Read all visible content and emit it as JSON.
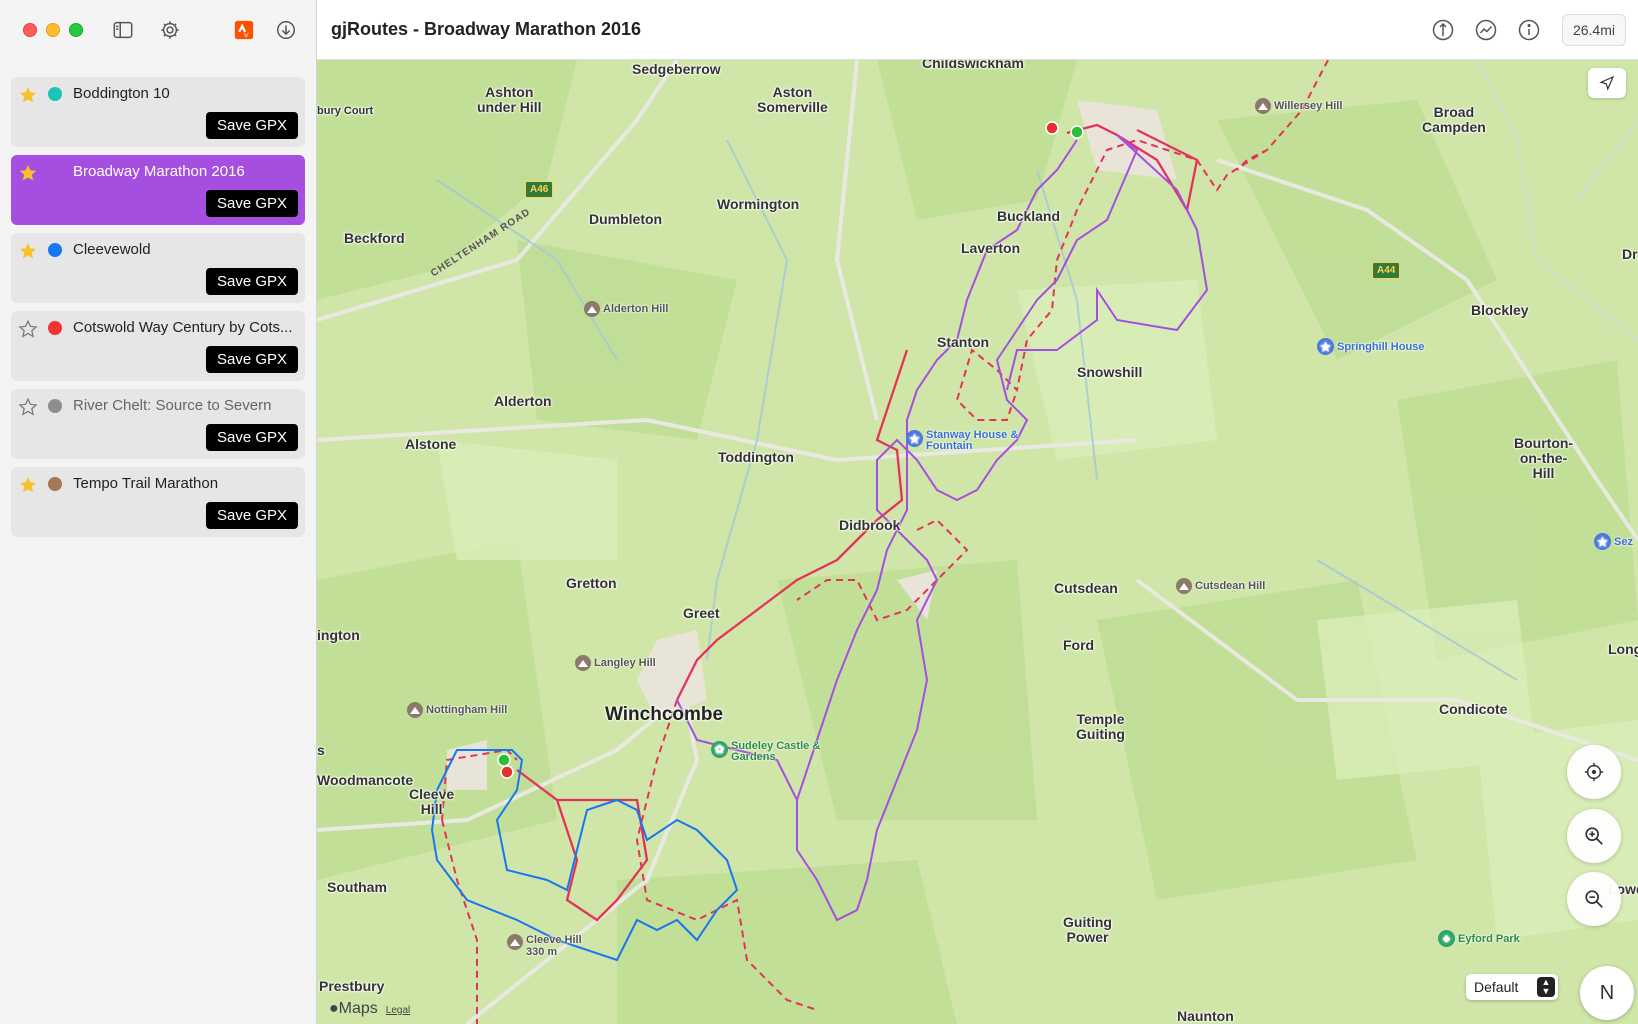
{
  "sidebar": {
    "routes": [
      {
        "name": "Boddington 10",
        "color": "#1cc3b9",
        "starred": true,
        "button": "Save GPX"
      },
      {
        "name": "Broadway Marathon 2016",
        "color": "#a54fe0",
        "starred": true,
        "button": "Save GPX",
        "selected": true
      },
      {
        "name": "Cleevewold",
        "color": "#1976f2",
        "starred": true,
        "button": "Save GPX"
      },
      {
        "name": "Cotswold Way Century by Cots...",
        "color": "#f03333",
        "starred": false,
        "button": "Save GPX"
      },
      {
        "name": "River Chelt: Source to Severn",
        "color": "#8e8e8e",
        "starred": false,
        "button": "Save GPX"
      },
      {
        "name": "Tempo Trail Marathon",
        "color": "#a37a55",
        "starred": true,
        "button": "Save GPX"
      }
    ]
  },
  "header": {
    "title": "gjRoutes - Broadway Marathon 2016",
    "distance": "26.4mi"
  },
  "map": {
    "places": {
      "sedgeberrow": "Sedgeberrow",
      "childswickham": "Childswickham",
      "ashton": "Ashton\nunder Hill",
      "aston": "Aston\nSomerville",
      "broad_campden": "Broad\nCampden",
      "dumbleton": "Dumbleton",
      "wormington": "Wormington",
      "buckland": "Buckland",
      "beckford": "Beckford",
      "laverton": "Laverton",
      "blockley": "Blockley",
      "stanton": "Stanton",
      "snowshill": "Snowshill",
      "alderton": "Alderton",
      "alstone": "Alstone",
      "toddington": "Toddington",
      "bourton": "Bourton-\non-the-\nHill",
      "didbrook": "Didbrook",
      "gretton": "Gretton",
      "cutsdean": "Cutsdean",
      "greet": "Greet",
      "ford": "Ford",
      "winchcombe": "Winchcombe",
      "temple_guiting": "Temple\nGuiting",
      "condicote": "Condicote",
      "woodmancote": "Woodmancote",
      "cleeve_hill": "Cleeve\nHill",
      "southam": "Southam",
      "guiting_power": "Guiting\nPower",
      "prestbury": "Prestbury",
      "naunton": "Naunton",
      "bury_court": "bury Court",
      "ington": "ington",
      "dr": "Dr",
      "long": "Long",
      "lower": "Lower",
      "s": "s"
    },
    "pois": {
      "willersey_hill": "Willersey Hill",
      "alderton_hill": "Alderton Hill",
      "springhill_house": "Springhill House",
      "stanway_house": "Stanway House &\nFountain",
      "cutsdean_hill": "Cutsdean Hill",
      "langley_hill": "Langley Hill",
      "nottingham_hill": "Nottingham Hill",
      "sudeley_castle": "Sudeley Castle &\nGardens",
      "cleeve_hill_poi": "Cleeve Hill\n330 m",
      "eyford_park": "Eyford Park",
      "sez": "Sez"
    },
    "roads": {
      "a46": "A46",
      "a44": "A44",
      "cheltenham_road": "CHELTENHAM ROAD"
    },
    "style_select": "Default",
    "compass": "N",
    "attribution": "Maps",
    "legal": "Legal"
  },
  "route_colors": {
    "purple": "#a54fe0",
    "red": "#e4335a",
    "blue": "#1976f2"
  }
}
